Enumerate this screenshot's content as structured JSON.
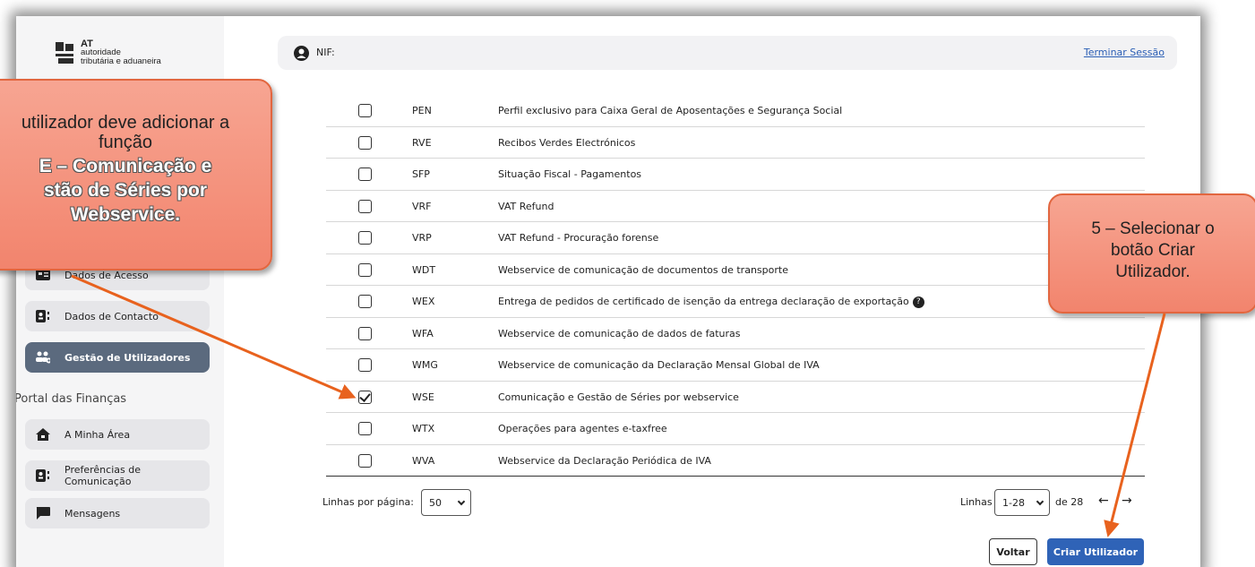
{
  "logo": {
    "line1": "AT",
    "line2": "autoridade",
    "line3": "tributária e aduaneira"
  },
  "topbar": {
    "nif_label": "NIF:",
    "logout": "Terminar Sessão"
  },
  "sidebar": {
    "items_top": [
      {
        "label": "Dados de Acesso",
        "icon": "id-card-icon"
      },
      {
        "label": "Dados de Contacto",
        "icon": "contact-card-icon"
      },
      {
        "label": "Gestão de Utilizadores",
        "icon": "users-gear-icon",
        "active": true
      }
    ],
    "section": "Portal das Finanças",
    "items_bottom": [
      {
        "label": "A Minha Área",
        "icon": "home-icon"
      },
      {
        "label": "Preferências de Comunicação",
        "icon": "contact-card-icon"
      },
      {
        "label": "Mensagens",
        "icon": "chat-icon"
      }
    ]
  },
  "table": {
    "rows": [
      {
        "code": "PEN",
        "desc": "Perfil exclusivo para Caixa Geral de Aposentações e Segurança Social",
        "checked": false
      },
      {
        "code": "RVE",
        "desc": "Recibos Verdes Electrónicos",
        "checked": false
      },
      {
        "code": "SFP",
        "desc": "Situação Fiscal - Pagamentos",
        "checked": false
      },
      {
        "code": "VRF",
        "desc": "VAT Refund",
        "checked": false
      },
      {
        "code": "VRP",
        "desc": "VAT Refund - Procuração forense",
        "checked": false
      },
      {
        "code": "WDT",
        "desc": "Webservice de comunicação de documentos de transporte",
        "checked": false
      },
      {
        "code": "WEX",
        "desc": "Entrega de pedidos de certificado de isenção da entrega declaração de exportação",
        "checked": false,
        "help": true
      },
      {
        "code": "WFA",
        "desc": "Webservice de comunicação de dados de faturas",
        "checked": false
      },
      {
        "code": "WMG",
        "desc": "Webservice de comunicação da Declaração Mensal Global de IVA",
        "checked": false
      },
      {
        "code": "WSE",
        "desc": "Comunicação e Gestão de Séries por webservice",
        "checked": true
      },
      {
        "code": "WTX",
        "desc": "Operações para agentes e-taxfree",
        "checked": false
      },
      {
        "code": "WVA",
        "desc": "Webservice da Declaração Periódica de IVA",
        "checked": false
      }
    ]
  },
  "pager": {
    "rows_per_page_label": "Linhas por página:",
    "rows_per_page_value": "50",
    "lines_label": "Linhas",
    "lines_value": "1-28",
    "of_total": "de 28",
    "prev": "←",
    "next": "→"
  },
  "buttons": {
    "voltar": "Voltar",
    "criar": "Criar Utilizador"
  },
  "callouts": {
    "left_line1": "utilizador deve adicionar a",
    "left_line2": "função",
    "left_bold1": "E – Comunicação e",
    "left_bold2": "stão de Séries por",
    "left_bold3": "Webservice.",
    "right_line1": "5 – Selecionar o",
    "right_line2": "botão Criar",
    "right_line3": "Utilizador."
  },
  "colors": {
    "accent": "#2f63b7",
    "sidebar_active": "#5b6a7e",
    "callout": "#f2846d",
    "arrow": "#e8621e"
  }
}
